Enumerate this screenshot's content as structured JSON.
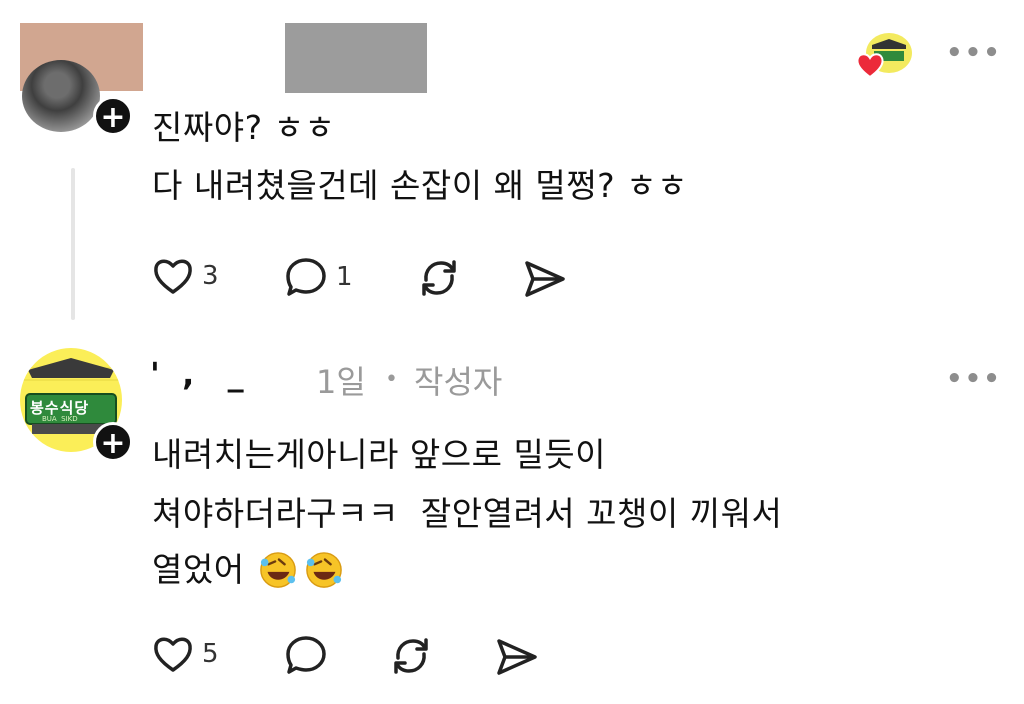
{
  "comment1": {
    "line1": "진짜야? ㅎㅎ",
    "line2": "다 내려쳤을건데 손잡이 왜 멀쩡? ㅎㅎ",
    "likes": "3",
    "replies": "1",
    "more_label": "•••"
  },
  "comment2": {
    "username_partial": "'  ,   _",
    "time": "1일",
    "separator": "•",
    "author_badge": "작성자",
    "more_label": "•••",
    "line1": "내려치는게아니라 앞으로 밀듯이",
    "line2": "쳐야하더라구ㅋㅋ  잘안열려서 꼬챙이 끼워서",
    "line3": "열었어",
    "likes": "5",
    "avatar_sign": "봉수식당",
    "avatar_sub": "BUA  SIKD"
  },
  "icons": {
    "add": "plus-icon",
    "like": "heart-icon",
    "reply": "comment-icon",
    "repost": "repost-icon",
    "share": "share-icon",
    "liked_by_author": "heart-badge-icon",
    "emoji": "rolling-on-floor-laughing-emoji"
  },
  "colors": {
    "accent_red": "#ec2a3a",
    "avatar_yellow": "#fbee58",
    "avatar_green": "#2f8a3c",
    "muted_gray": "#9a9a9a"
  }
}
